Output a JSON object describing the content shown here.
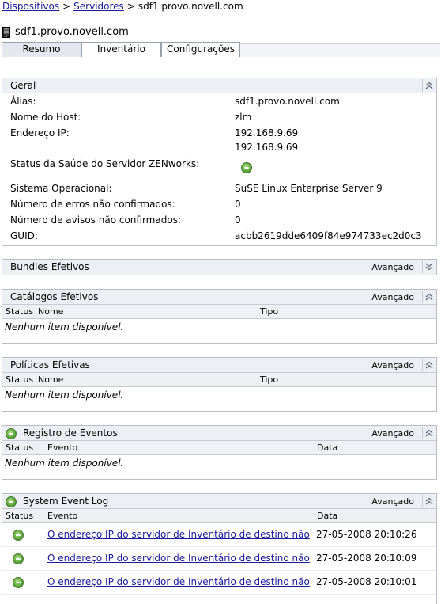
{
  "breadcrumb": {
    "items": [
      "Dispositivos",
      "Servidores"
    ],
    "separator": ">",
    "current": "sdf1.provo.novell.com"
  },
  "page": {
    "title": "sdf1.provo.novell.com",
    "icon": "server-icon"
  },
  "tabs": [
    {
      "label": "Resumo",
      "active": true
    },
    {
      "label": "Inventário",
      "active": false
    },
    {
      "label": "Configurações",
      "active": false
    }
  ],
  "geral": {
    "title": "Geral",
    "fields": [
      {
        "label": "Álias:",
        "value": "sdf1.provo.novell.com"
      },
      {
        "label": "Nome do Host:",
        "value": "zlm"
      },
      {
        "label": "Endereço IP:",
        "value": "192.168.9.69",
        "value2": "192.168.9.69"
      },
      {
        "label": "Status da Saúde do Servidor ZENworks:",
        "value_icon": "ok-status-icon"
      },
      {
        "label": "Sistema Operacional:",
        "value": "SuSE Linux Enterprise Server 9"
      },
      {
        "label": "Número de erros não confirmados:",
        "value": "0"
      },
      {
        "label": "Número de avisos não confirmados:",
        "value": "0"
      },
      {
        "label": "GUID:",
        "value": "acbb2619dde6409f84e974733ec2d0c3"
      }
    ]
  },
  "bundles": {
    "title": "Bundles Efetivos",
    "advanced": "Avançado"
  },
  "catalogos": {
    "title": "Catálogos Efetivos",
    "advanced": "Avançado",
    "columns": [
      "Status",
      "Nome",
      "Tipo"
    ],
    "empty": "Nenhum item disponível."
  },
  "politicas": {
    "title": "Políticas Efetivas",
    "advanced": "Avançado",
    "columns": [
      "Status",
      "Nome",
      "Tipo"
    ],
    "empty": "Nenhum item disponível."
  },
  "registro": {
    "title": "Registro de Eventos",
    "advanced": "Avançado",
    "columns": [
      "Status",
      "Evento",
      "Data"
    ],
    "empty": "Nenhum item disponível."
  },
  "syslog": {
    "title": "System Event Log",
    "advanced": "Avançado",
    "columns": [
      "Status",
      "Evento",
      "Data"
    ],
    "rows": [
      {
        "event": "O endereço IP do servidor de Inventário de destino não",
        "date": "27-05-2008 20:10:26"
      },
      {
        "event": "O endereço IP do servidor de Inventário de destino não",
        "date": "27-05-2008 20:10:09"
      },
      {
        "event": "O endereço IP do servidor de Inventário de destino não",
        "date": "27-05-2008 20:10:01"
      }
    ]
  },
  "colors": {
    "link": "#1a1a9c",
    "panel_header": "#eceff3",
    "border": "#b9bec6",
    "status_ok": "#6ab344"
  }
}
